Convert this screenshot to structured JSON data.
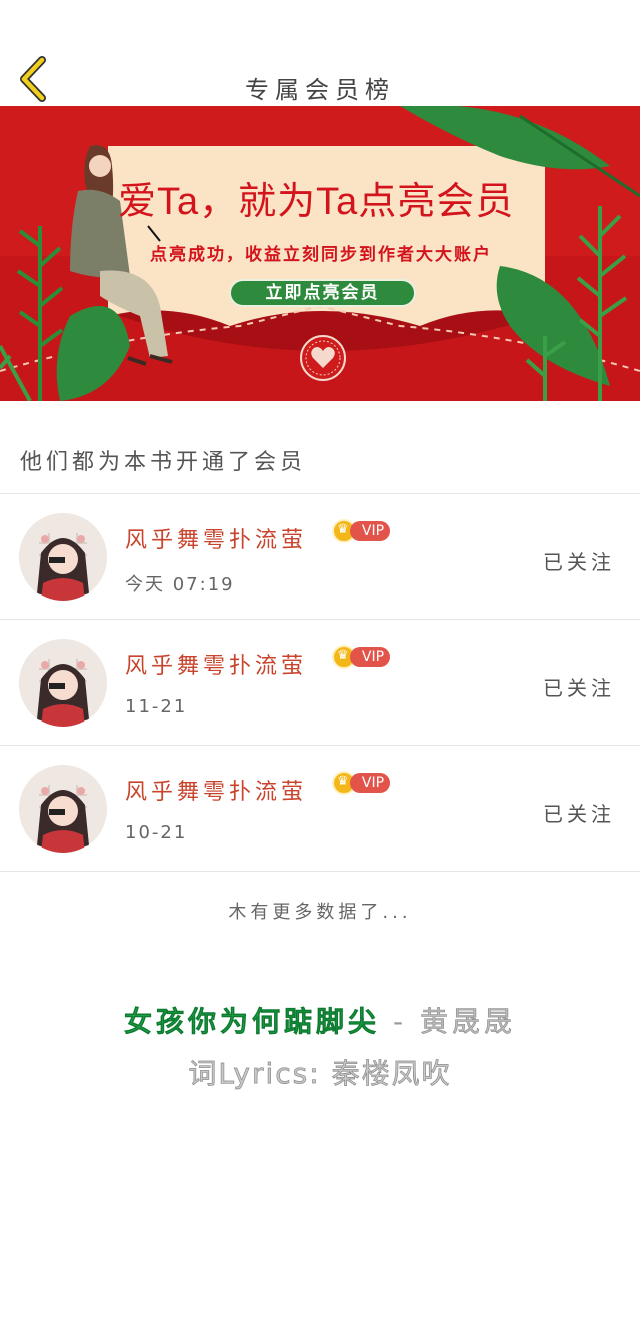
{
  "header": {
    "title": "专属会员榜",
    "back_icon": "chevron-left-icon",
    "accent_color": "#f2cf1c"
  },
  "banner": {
    "headline": "爱Ta，就为Ta点亮会员",
    "subtitle": "点亮成功，收益立刻同步到作者大大账户",
    "button_label": "立即点亮会员",
    "background_color": "#cf1b1b",
    "button_color": "#2e8a3c"
  },
  "section": {
    "heading": "他们都为本书开通了会员"
  },
  "members": [
    {
      "name": "风乎舞雩扑流萤",
      "badge": "VIP",
      "date": "今天 07:19",
      "follow_label": "已关注"
    },
    {
      "name": "风乎舞雩扑流萤",
      "badge": "VIP",
      "date": "11-21",
      "follow_label": "已关注"
    },
    {
      "name": "风乎舞雩扑流萤",
      "badge": "VIP",
      "date": "10-21",
      "follow_label": "已关注"
    }
  ],
  "footer": {
    "no_more": "木有更多数据了...",
    "song_title": "女孩你为何踮脚尖",
    "song_separator": "-",
    "song_artist": "黄晟晟",
    "lyrics_credit": "词Lyrics: 秦楼凤吹"
  }
}
